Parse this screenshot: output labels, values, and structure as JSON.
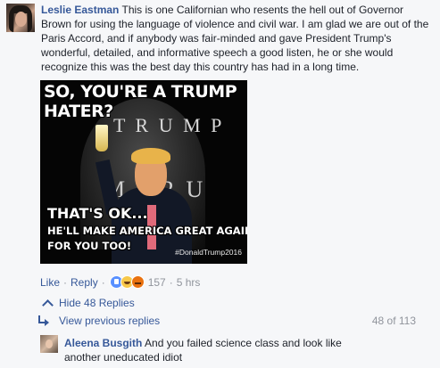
{
  "comment": {
    "author": "Leslie Eastman",
    "text": "This is one Californian who resents the hell out of Governor Brown for using the language of violence and civil war. I am glad we are out of the Paris Accord, and if anybody was fair-minded and gave President Trump's wonderful, detailed, and informative speech a good listen, he or she would recognize this was the best day this country has had in a long time."
  },
  "meme": {
    "top_text": "SO, YOU'RE A TRUMP HATER?",
    "building_text_1": "T R U M P",
    "building_text_2": "M P  R U",
    "ok_text": "THAT'S OK...",
    "body_text": "HE'LL MAKE AMERICA GREAT AGAIN,\nFOR YOU TOO!",
    "hashtag": "#DonaldTrump2016"
  },
  "actions": {
    "like": "Like",
    "reply": "Reply",
    "reaction_count": "157",
    "time": "5 hrs",
    "reaction_icons": [
      "like-reaction-icon",
      "haha-reaction-icon",
      "angry-reaction-icon"
    ]
  },
  "replies": {
    "hide_label": "Hide 48 Replies",
    "view_previous": "View previous replies",
    "pager": "48 of 113"
  },
  "reply": {
    "author": "Aleena Busgith",
    "text": "And you failed science class and look like another uneducated idiot"
  },
  "colors": {
    "link": "#365899",
    "muted": "#90949c",
    "background": "#f6f7f9"
  }
}
